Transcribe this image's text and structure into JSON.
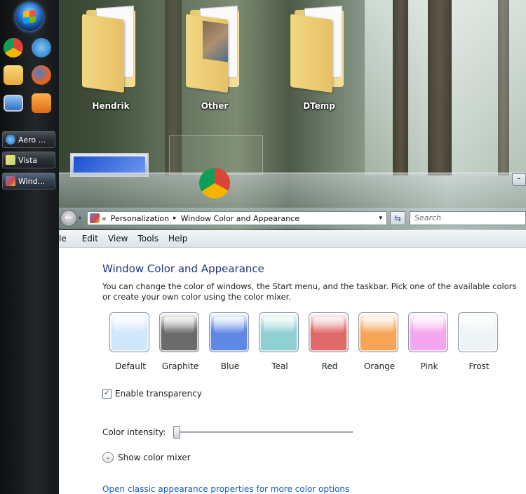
{
  "desktop": {
    "icons": [
      {
        "label": "Hendrik"
      },
      {
        "label": "Other"
      },
      {
        "label": "DTemp"
      }
    ]
  },
  "taskbar": {
    "buttons": [
      {
        "label": "Aero ...",
        "icon": "ie-icon"
      },
      {
        "label": "Vista",
        "icon": "notepad-icon"
      },
      {
        "label": "Wind...",
        "icon": "control-panel-icon"
      }
    ],
    "quicklaunch": [
      "chrome-icon",
      "ie-icon",
      "mail-icon",
      "firefox-icon",
      "show-desktop-icon",
      "media-player-icon"
    ]
  },
  "window": {
    "minimize_glyph": "–",
    "navbar": {
      "back_glyph": "←",
      "address": {
        "overflow": "«",
        "crumb1": "Personalization",
        "sep": "▸",
        "crumb2": "Window Color and Appearance",
        "dropdown": "▾"
      },
      "refresh_glyph": "⇆",
      "search_placeholder": "Search"
    },
    "menu": [
      "le",
      "Edit",
      "View",
      "Tools",
      "Help"
    ],
    "page_title": "Window Color and Appearance",
    "description": "You can change the color of windows, the Start menu, and the taskbar. Pick one of the available colors or create your own color using the color mixer.",
    "swatches": [
      {
        "label": "Default",
        "color": "#cfe6fb"
      },
      {
        "label": "Graphite",
        "color": "#6b6b6b"
      },
      {
        "label": "Blue",
        "color": "#5f88e6"
      },
      {
        "label": "Teal",
        "color": "#8fd0d2"
      },
      {
        "label": "Red",
        "color": "#e06a6a"
      },
      {
        "label": "Orange",
        "color": "#f6a455"
      },
      {
        "label": "Pink",
        "color": "#f4a6ee"
      },
      {
        "label": "Frost",
        "color": "#eef3f3"
      }
    ],
    "transparency": {
      "label": "Enable transparency",
      "checked": true
    },
    "intensity": {
      "label": "Color intensity:",
      "value": 0.0
    },
    "mixer_label": "Show color mixer",
    "classic_link": "Open classic appearance properties for more color options"
  }
}
